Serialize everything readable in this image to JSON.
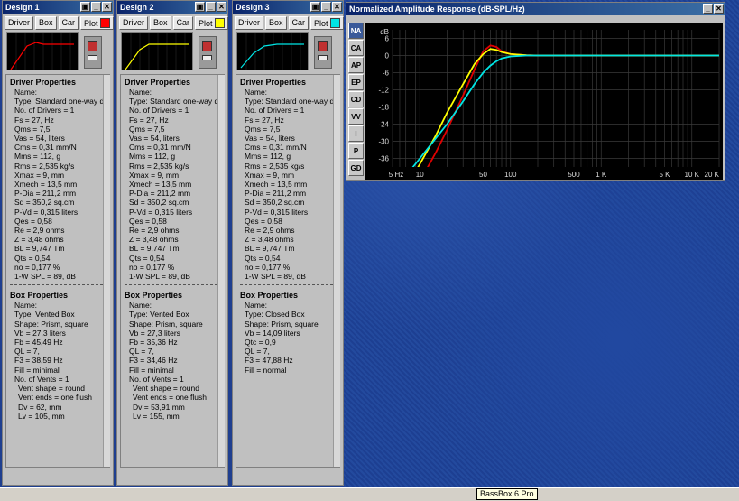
{
  "designs": [
    {
      "title": "Design 1",
      "color": "#ff0000",
      "toolbar": [
        "Driver",
        "Box",
        "Car"
      ],
      "plot_label": "Plot",
      "driver_header": "Driver Properties",
      "driver": [
        "Name:",
        "Type: Standard one-way driv",
        "No. of Drivers = 1",
        "Fs = 27, Hz",
        "Qms = 7,5",
        "Vas = 54, liters",
        "Cms = 0,31 mm/N",
        "Mms = 112, g",
        "Rms = 2,535 kg/s",
        "Xmax = 9, mm",
        "Xmech = 13,5 mm",
        "P-Dia = 211,2 mm",
        "Sd = 350,2 sq.cm",
        "P-Vd = 0,315 liters",
        "Qes = 0,58",
        "Re = 2,9 ohms",
        "Z = 3,48 ohms",
        "BL = 9,747 Tm",
        "Qts = 0,54",
        "no = 0,177 %",
        "1-W SPL = 89, dB"
      ],
      "box_header": "Box Properties",
      "box": [
        "Name:",
        "Type: Vented Box",
        "Shape: Prism, square",
        "Vb = 27,3 liters",
        "Fb = 45,49 Hz",
        "QL = 7,",
        "F3 = 38,59 Hz",
        "Fill = minimal",
        "No. of Vents = 1",
        "Vent shape = round",
        "Vent ends = one flush",
        "Dv = 62, mm",
        "Lv = 105, mm"
      ]
    },
    {
      "title": "Design 2",
      "color": "#ffff00",
      "toolbar": [
        "Driver",
        "Box",
        "Car"
      ],
      "plot_label": "Plot",
      "driver_header": "Driver Properties",
      "driver": [
        "Name:",
        "Type: Standard one-way driv",
        "No. of Drivers = 1",
        "Fs = 27, Hz",
        "Qms = 7,5",
        "Vas = 54, liters",
        "Cms = 0,31 mm/N",
        "Mms = 112, g",
        "Rms = 2,535 kg/s",
        "Xmax = 9, mm",
        "Xmech = 13,5 mm",
        "P-Dia = 211,2 mm",
        "Sd = 350,2 sq.cm",
        "P-Vd = 0,315 liters",
        "Qes = 0,58",
        "Re = 2,9 ohms",
        "Z = 3,48 ohms",
        "BL = 9,747 Tm",
        "Qts = 0,54",
        "no = 0,177 %",
        "1-W SPL = 89, dB"
      ],
      "box_header": "Box Properties",
      "box": [
        "Name:",
        "Type: Vented Box",
        "Shape: Prism, square",
        "Vb = 27,3 liters",
        "Fb = 35,36 Hz",
        "QL = 7,",
        "F3 = 34,46 Hz",
        "Fill = minimal",
        "No. of Vents = 1",
        "Vent shape = round",
        "Vent ends = one flush",
        "Dv = 53,91 mm",
        "Lv = 155, mm"
      ]
    },
    {
      "title": "Design 3",
      "color": "#00e5e5",
      "toolbar": [
        "Driver",
        "Box",
        "Car"
      ],
      "plot_label": "Plot",
      "driver_header": "Driver Properties",
      "driver": [
        "Name:",
        "Type: Standard one-way driv",
        "No. of Drivers = 1",
        "Fs = 27, Hz",
        "Qms = 7,5",
        "Vas = 54, liters",
        "Cms = 0,31 mm/N",
        "Mms = 112, g",
        "Rms = 2,535 kg/s",
        "Xmax = 9, mm",
        "Xmech = 13,5 mm",
        "P-Dia = 211,2 mm",
        "Sd = 350,2 sq.cm",
        "P-Vd = 0,315 liters",
        "Qes = 0,58",
        "Re = 2,9 ohms",
        "Z = 3,48 ohms",
        "BL = 9,747 Tm",
        "Qts = 0,54",
        "no = 0,177 %",
        "1-W SPL = 89, dB"
      ],
      "box_header": "Box Properties",
      "box": [
        "Name:",
        "Type: Closed Box",
        "Shape: Prism, square",
        "Vb = 14,09 liters",
        "Qtc = 0,9",
        "QL = 7,",
        "F3 = 47,88 Hz",
        "Fill = normal"
      ]
    }
  ],
  "amp": {
    "title": "Normalized Amplitude Response (dB-SPL/Hz)",
    "side_buttons": [
      "NA",
      "CA",
      "AP",
      "EP",
      "CD",
      "VV",
      "I",
      "P",
      "GD"
    ],
    "y_unit": "dB",
    "y_ticks": [
      "6",
      "0",
      "-6",
      "-12",
      "-18",
      "-24",
      "-30",
      "-36"
    ],
    "x_ticks": [
      "5 Hz",
      "10",
      "50",
      "100",
      "500",
      "1 K",
      "5 K",
      "10 K",
      "20 K"
    ]
  },
  "chart_data": {
    "type": "line",
    "xlabel": "",
    "ylabel": "dB",
    "xscale": "log",
    "xlim": [
      5,
      20000
    ],
    "ylim": [
      -39,
      9
    ],
    "grid": true,
    "series": [
      {
        "color": "#e00000",
        "x": [
          5,
          10,
          15,
          20,
          30,
          40,
          50,
          60,
          70,
          80,
          100,
          150,
          200,
          500,
          1000,
          20000
        ],
        "y": [
          -60,
          -44,
          -34,
          -26,
          -14,
          -5,
          1.5,
          3.5,
          3,
          1.5,
          0.5,
          0.1,
          0,
          0,
          0,
          0
        ]
      },
      {
        "color": "#ffff00",
        "x": [
          5,
          10,
          15,
          20,
          30,
          40,
          50,
          60,
          70,
          80,
          100,
          150,
          200,
          500,
          1000,
          20000
        ],
        "y": [
          -54,
          -38,
          -28,
          -20,
          -10,
          -3,
          0.5,
          2.3,
          2,
          1.2,
          0.5,
          0.1,
          0,
          0,
          0,
          0
        ]
      },
      {
        "color": "#00e5e5",
        "x": [
          5,
          10,
          15,
          20,
          30,
          40,
          50,
          60,
          70,
          80,
          100,
          150,
          200,
          500,
          1000,
          20000
        ],
        "y": [
          -48,
          -36,
          -29,
          -24,
          -16,
          -10,
          -6,
          -3.5,
          -2,
          -1,
          -0.3,
          0,
          0,
          0,
          0,
          0
        ]
      }
    ]
  },
  "tooltip": "BassBox 6 Pro"
}
